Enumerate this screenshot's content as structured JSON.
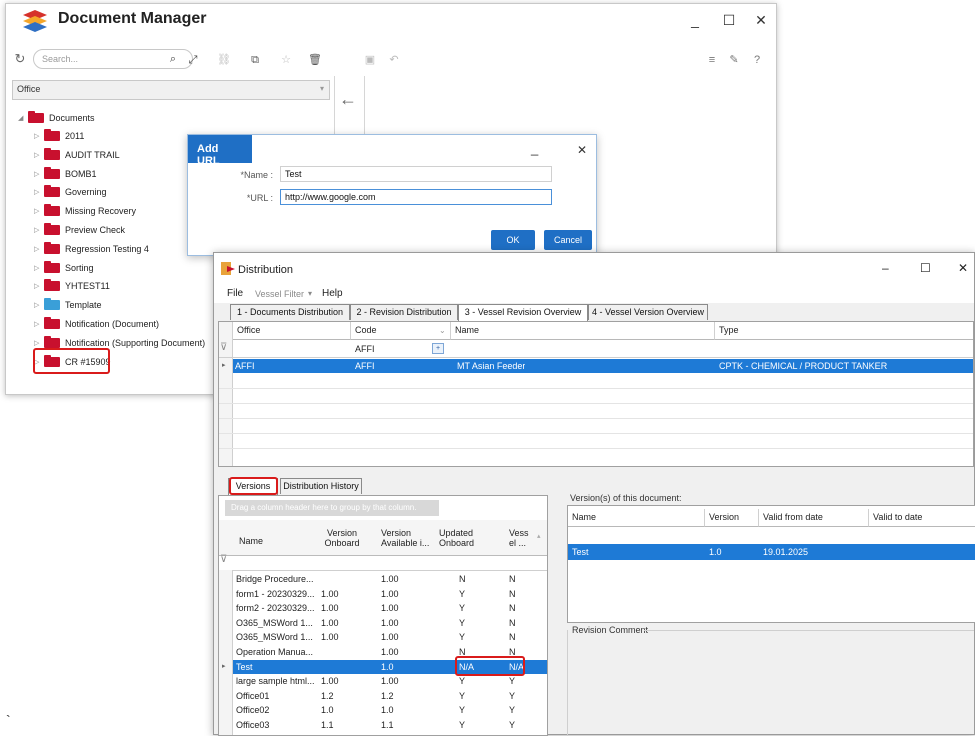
{
  "doc_manager": {
    "title": "Document Manager",
    "window_controls": {
      "minimize": "_",
      "maximize": "☐",
      "close": "✕"
    },
    "search_placeholder": "Search...",
    "office_selected": "Office",
    "tree_root": "Documents",
    "tree_items": [
      {
        "label": "2011",
        "color": "red"
      },
      {
        "label": "AUDIT TRAIL",
        "color": "red"
      },
      {
        "label": "BOMB1",
        "color": "red"
      },
      {
        "label": "Governing",
        "color": "red"
      },
      {
        "label": "Missing Recovery",
        "color": "red"
      },
      {
        "label": "Preview Check",
        "color": "red"
      },
      {
        "label": "Regression Testing 4",
        "color": "red"
      },
      {
        "label": "Sorting",
        "color": "red"
      },
      {
        "label": "YHTEST11",
        "color": "red"
      },
      {
        "label": "Template",
        "color": "blue"
      },
      {
        "label": "Notification (Document)",
        "color": "red"
      },
      {
        "label": "Notification (Supporting Document)",
        "color": "red"
      },
      {
        "label": "CR #15909",
        "color": "red"
      }
    ]
  },
  "add_url_dialog": {
    "title": "Add URL",
    "name_label": "*Name :",
    "name_value": "Test",
    "url_label": "*URL :",
    "url_value": "http://www.google.com",
    "ok_label": "OK",
    "cancel_label": "Cancel",
    "minimize": "_",
    "close": "✕"
  },
  "distribution": {
    "title": "Distribution",
    "window_controls": {
      "minimize": "–",
      "maximize": "☐",
      "close": "✕"
    },
    "menu": {
      "file": "File",
      "vessel_filter": "Vessel Filter",
      "vessel_filter_arrow": "▾",
      "help": "Help"
    },
    "tabs": [
      "1 - Documents Distribution",
      "2 - Revision Distribution",
      "3 - Vessel Revision Overview",
      "4 - Vessel Version Overview"
    ],
    "top_grid": {
      "columns": [
        "Office",
        "Code",
        "Name",
        "Type"
      ],
      "filter_code": "AFFI",
      "row": {
        "office": "AFFI",
        "code": "AFFI",
        "name": "MT Asian Feeder",
        "type": "CPTK - CHEMICAL / PRODUCT TANKER"
      }
    },
    "bottom_tabs": [
      "Versions",
      "Distribution History"
    ],
    "group_hint": "Drag a column header here to group by that column.",
    "versions_columns": [
      "Name",
      "Version Onboard",
      "Version Available i...",
      "Updated Onboard",
      "Vess el ..."
    ],
    "versions_rows": [
      {
        "name": "Bridge Procedure...",
        "onboard": "",
        "available": "1.00",
        "updated": "N",
        "vessel": "N"
      },
      {
        "name": "form1 - 20230329...",
        "onboard": "1.00",
        "available": "1.00",
        "updated": "Y",
        "vessel": "N"
      },
      {
        "name": "form2 - 20230329...",
        "onboard": "1.00",
        "available": "1.00",
        "updated": "Y",
        "vessel": "N"
      },
      {
        "name": "O365_MSWord 1...",
        "onboard": "1.00",
        "available": "1.00",
        "updated": "Y",
        "vessel": "N"
      },
      {
        "name": "O365_MSWord 1...",
        "onboard": "1.00",
        "available": "1.00",
        "updated": "Y",
        "vessel": "N"
      },
      {
        "name": "Operation Manua...",
        "onboard": "",
        "available": "1.00",
        "updated": "N",
        "vessel": "N"
      },
      {
        "name": "Test",
        "onboard": "",
        "available": "1.0",
        "updated": "N/A",
        "vessel": "N/A",
        "selected": true
      },
      {
        "name": "large sample html...",
        "onboard": "1.00",
        "available": "1.00",
        "updated": "Y",
        "vessel": "Y"
      },
      {
        "name": "Office01",
        "onboard": "1.2",
        "available": "1.2",
        "updated": "Y",
        "vessel": "Y"
      },
      {
        "name": "Office02",
        "onboard": "1.0",
        "available": "1.0",
        "updated": "Y",
        "vessel": "Y"
      },
      {
        "name": "Office03",
        "onboard": "1.1",
        "available": "1.1",
        "updated": "Y",
        "vessel": "Y"
      }
    ],
    "doc_versions_label": "Version(s) of this document:",
    "doc_versions_columns": [
      "Name",
      "Version",
      "Valid from date",
      "Valid to date"
    ],
    "doc_versions_row": {
      "name": "Test",
      "version": "1.0",
      "valid_from": "19.01.2025",
      "valid_to": ""
    },
    "revision_comment_label": "Revision Comment"
  },
  "colors": {
    "accent": "#1f6fc5",
    "selection": "#1e7ad6",
    "highlight": "#d91b1b",
    "folder_red": "#c8102e",
    "folder_blue": "#3a9fd8"
  }
}
